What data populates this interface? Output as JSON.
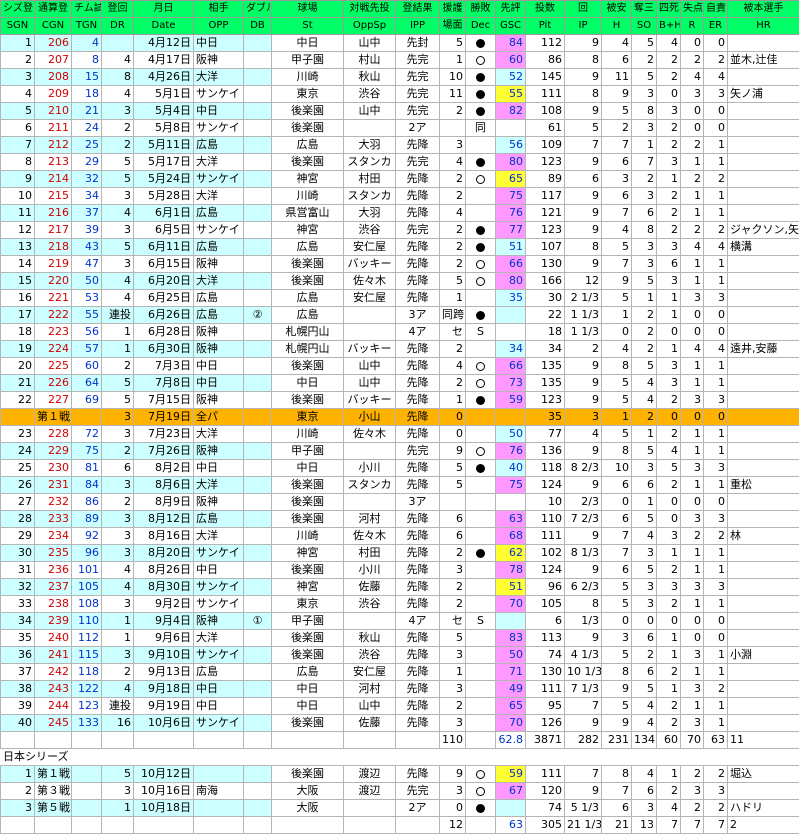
{
  "headers_jp": [
    "シズ登",
    "通算登",
    "チム試",
    "登回",
    "月日",
    "相手",
    "ダブル",
    "球場",
    "対戦先投",
    "登結果",
    "援護",
    "勝敗",
    "先評",
    "投数",
    "回",
    "被安",
    "奪三",
    "四死",
    "失点",
    "自責",
    "被本選手"
  ],
  "headers_en": [
    "SGN",
    "CGN",
    "TGN",
    "DR",
    "Date",
    "OPP",
    "DB",
    "St",
    "OppSp",
    "IPP",
    "場面",
    "Dec",
    "GSC",
    "Pit",
    "IP",
    "H",
    "SO",
    "B+H",
    "R",
    "ER",
    "HR"
  ],
  "rows": [
    {
      "sgn": "1",
      "cgn": "206",
      "tgn": "4",
      "dr": "",
      "date": "4月12日",
      "opp": "中日",
      "db": "",
      "st": "中日",
      "oppsp": "山中",
      "ipp": "先封",
      "sup": "5",
      "dec": "win",
      "gsc": "84",
      "gscColor": "pink",
      "pit": "112",
      "ip": "9",
      "h": "4",
      "so": "5",
      "bh": "4",
      "r": "0",
      "er": "0",
      "hr": ""
    },
    {
      "sgn": "2",
      "cgn": "207",
      "tgn": "8",
      "dr": "4",
      "date": "4月17日",
      "opp": "阪神",
      "db": "",
      "st": "甲子園",
      "oppsp": "村山",
      "ipp": "先完",
      "sup": "1",
      "dec": "loss",
      "gsc": "60",
      "gscColor": "pink",
      "pit": "86",
      "ip": "8",
      "h": "6",
      "so": "2",
      "bh": "2",
      "r": "2",
      "er": "2",
      "hr": "並木,辻佳"
    },
    {
      "sgn": "3",
      "cgn": "208",
      "tgn": "15",
      "dr": "8",
      "date": "4月26日",
      "opp": "大洋",
      "db": "",
      "st": "川崎",
      "oppsp": "秋山",
      "ipp": "先完",
      "sup": "10",
      "dec": "win",
      "gsc": "52",
      "gscColor": "cyan",
      "pit": "145",
      "ip": "9",
      "h": "11",
      "so": "5",
      "bh": "2",
      "r": "4",
      "er": "4",
      "hr": ""
    },
    {
      "sgn": "4",
      "cgn": "209",
      "tgn": "18",
      "dr": "4",
      "date": "5月1日",
      "opp": "サンケイ",
      "db": "",
      "st": "東京",
      "oppsp": "渋谷",
      "ipp": "先完",
      "sup": "11",
      "dec": "win",
      "gsc": "55",
      "gscColor": "yellow",
      "pit": "111",
      "ip": "8",
      "h": "9",
      "so": "3",
      "bh": "0",
      "r": "3",
      "er": "3",
      "hr": "矢ノ浦"
    },
    {
      "sgn": "5",
      "cgn": "210",
      "tgn": "21",
      "dr": "3",
      "date": "5月4日",
      "opp": "中日",
      "db": "",
      "st": "後楽園",
      "oppsp": "山中",
      "ipp": "先完",
      "sup": "2",
      "dec": "win",
      "gsc": "82",
      "gscColor": "pink",
      "pit": "108",
      "ip": "9",
      "h": "5",
      "so": "8",
      "bh": "3",
      "r": "0",
      "er": "0",
      "hr": ""
    },
    {
      "sgn": "6",
      "cgn": "211",
      "tgn": "24",
      "dr": "2",
      "date": "5月8日",
      "opp": "サンケイ",
      "db": "",
      "st": "後楽園",
      "oppsp": "",
      "ipp": "2ア",
      "sup": "",
      "dec": "同",
      "gsc": "",
      "gscColor": "",
      "pit": "61",
      "ip": "5",
      "h": "2",
      "so": "3",
      "bh": "2",
      "r": "0",
      "er": "0",
      "hr": ""
    },
    {
      "sgn": "7",
      "cgn": "212",
      "tgn": "25",
      "dr": "2",
      "date": "5月11日",
      "opp": "広島",
      "db": "",
      "st": "広島",
      "oppsp": "大羽",
      "ipp": "先降",
      "sup": "3",
      "dec": "",
      "gsc": "56",
      "gscColor": "cyan",
      "pit": "109",
      "ip": "7",
      "h": "7",
      "so": "1",
      "bh": "2",
      "r": "2",
      "er": "1",
      "hr": ""
    },
    {
      "sgn": "8",
      "cgn": "213",
      "tgn": "29",
      "dr": "5",
      "date": "5月17日",
      "opp": "大洋",
      "db": "",
      "st": "後楽園",
      "oppsp": "スタンカ",
      "ipp": "先完",
      "sup": "4",
      "dec": "win",
      "gsc": "80",
      "gscColor": "pink",
      "pit": "123",
      "ip": "9",
      "h": "6",
      "so": "7",
      "bh": "3",
      "r": "1",
      "er": "1",
      "hr": ""
    },
    {
      "sgn": "9",
      "cgn": "214",
      "tgn": "32",
      "dr": "5",
      "date": "5月24日",
      "opp": "サンケイ",
      "db": "",
      "st": "神宮",
      "oppsp": "村田",
      "ipp": "先降",
      "sup": "2",
      "dec": "loss",
      "gsc": "65",
      "gscColor": "yellow",
      "pit": "89",
      "ip": "6",
      "h": "3",
      "so": "2",
      "bh": "1",
      "r": "2",
      "er": "2",
      "hr": ""
    },
    {
      "sgn": "10",
      "cgn": "215",
      "tgn": "34",
      "dr": "3",
      "date": "5月28日",
      "opp": "大洋",
      "db": "",
      "st": "川崎",
      "oppsp": "スタンカ",
      "ipp": "先降",
      "sup": "2",
      "dec": "",
      "gsc": "75",
      "gscColor": "pink",
      "pit": "117",
      "ip": "9",
      "h": "6",
      "so": "3",
      "bh": "2",
      "r": "1",
      "er": "1",
      "hr": ""
    },
    {
      "sgn": "11",
      "cgn": "216",
      "tgn": "37",
      "dr": "4",
      "date": "6月1日",
      "opp": "広島",
      "db": "",
      "st": "県営富山",
      "oppsp": "大羽",
      "ipp": "先降",
      "sup": "4",
      "dec": "",
      "gsc": "76",
      "gscColor": "pink",
      "pit": "121",
      "ip": "9",
      "h": "7",
      "so": "6",
      "bh": "2",
      "r": "1",
      "er": "1",
      "hr": ""
    },
    {
      "sgn": "12",
      "cgn": "217",
      "tgn": "39",
      "dr": "3",
      "date": "6月5日",
      "opp": "サンケイ",
      "db": "",
      "st": "神宮",
      "oppsp": "渋谷",
      "ipp": "先完",
      "sup": "2",
      "dec": "win",
      "gsc": "77",
      "gscColor": "pink",
      "pit": "123",
      "ip": "9",
      "h": "4",
      "so": "8",
      "bh": "2",
      "r": "2",
      "er": "2",
      "hr": "ジャクソン,矢ノ浦"
    },
    {
      "sgn": "13",
      "cgn": "218",
      "tgn": "43",
      "dr": "5",
      "date": "6月11日",
      "opp": "広島",
      "db": "",
      "st": "広島",
      "oppsp": "安仁屋",
      "ipp": "先降",
      "sup": "2",
      "dec": "win",
      "gsc": "51",
      "gscColor": "cyan",
      "pit": "107",
      "ip": "8",
      "h": "5",
      "so": "3",
      "bh": "3",
      "r": "4",
      "er": "4",
      "hr": "横溝"
    },
    {
      "sgn": "14",
      "cgn": "219",
      "tgn": "47",
      "dr": "3",
      "date": "6月15日",
      "opp": "阪神",
      "db": "",
      "st": "後楽園",
      "oppsp": "バッキー",
      "ipp": "先降",
      "sup": "2",
      "dec": "loss",
      "gsc": "66",
      "gscColor": "pink",
      "pit": "130",
      "ip": "9",
      "h": "7",
      "so": "3",
      "bh": "6",
      "r": "1",
      "er": "1",
      "hr": ""
    },
    {
      "sgn": "15",
      "cgn": "220",
      "tgn": "50",
      "dr": "4",
      "date": "6月20日",
      "opp": "大洋",
      "db": "",
      "st": "後楽園",
      "oppsp": "佐々木",
      "ipp": "先降",
      "sup": "5",
      "dec": "loss",
      "gsc": "80",
      "gscColor": "pink",
      "pit": "166",
      "ip": "12",
      "h": "9",
      "so": "5",
      "bh": "3",
      "r": "1",
      "er": "1",
      "hr": ""
    },
    {
      "sgn": "16",
      "cgn": "221",
      "tgn": "53",
      "dr": "4",
      "date": "6月25日",
      "opp": "広島",
      "db": "",
      "st": "広島",
      "oppsp": "安仁屋",
      "ipp": "先降",
      "sup": "1",
      "dec": "",
      "gsc": "35",
      "gscColor": "cyan",
      "pit": "30",
      "ip": "2 1/3",
      "h": "5",
      "so": "1",
      "bh": "1",
      "r": "3",
      "er": "3",
      "hr": ""
    },
    {
      "sgn": "17",
      "cgn": "222",
      "tgn": "55",
      "dr": "連投",
      "date": "6月26日",
      "opp": "広島",
      "db": "②",
      "st": "広島",
      "oppsp": "",
      "ipp": "3ア",
      "sup": "同跨",
      "dec": "win",
      "gsc": "",
      "gscColor": "",
      "pit": "22",
      "ip": "1 1/3",
      "h": "1",
      "so": "2",
      "bh": "1",
      "r": "0",
      "er": "0",
      "hr": ""
    },
    {
      "sgn": "18",
      "cgn": "223",
      "tgn": "56",
      "dr": "1",
      "date": "6月28日",
      "opp": "阪神",
      "db": "",
      "st": "札幌円山",
      "oppsp": "",
      "ipp": "4ア",
      "sup": "セ",
      "dec": "S",
      "gsc": "",
      "gscColor": "",
      "pit": "18",
      "ip": "1 1/3",
      "h": "0",
      "so": "2",
      "bh": "0",
      "r": "0",
      "er": "0",
      "hr": ""
    },
    {
      "sgn": "19",
      "cgn": "224",
      "tgn": "57",
      "dr": "1",
      "date": "6月30日",
      "opp": "阪神",
      "db": "",
      "st": "札幌円山",
      "oppsp": "バッキー",
      "ipp": "先降",
      "sup": "2",
      "dec": "",
      "gsc": "34",
      "gscColor": "cyan",
      "pit": "34",
      "ip": "2",
      "h": "4",
      "so": "2",
      "bh": "1",
      "r": "4",
      "er": "4",
      "hr": "遠井,安藤"
    },
    {
      "sgn": "20",
      "cgn": "225",
      "tgn": "60",
      "dr": "2",
      "date": "7月3日",
      "opp": "中日",
      "db": "",
      "st": "後楽園",
      "oppsp": "山中",
      "ipp": "先降",
      "sup": "4",
      "dec": "loss",
      "gsc": "66",
      "gscColor": "pink",
      "pit": "135",
      "ip": "9",
      "h": "8",
      "so": "5",
      "bh": "3",
      "r": "1",
      "er": "1",
      "hr": ""
    },
    {
      "sgn": "21",
      "cgn": "226",
      "tgn": "64",
      "dr": "5",
      "date": "7月8日",
      "opp": "中日",
      "db": "",
      "st": "中日",
      "oppsp": "山中",
      "ipp": "先降",
      "sup": "2",
      "dec": "loss",
      "gsc": "73",
      "gscColor": "pink",
      "pit": "135",
      "ip": "9",
      "h": "5",
      "so": "4",
      "bh": "3",
      "r": "1",
      "er": "1",
      "hr": ""
    },
    {
      "sgn": "22",
      "cgn": "227",
      "tgn": "69",
      "dr": "5",
      "date": "7月15日",
      "opp": "阪神",
      "db": "",
      "st": "後楽園",
      "oppsp": "バッキー",
      "ipp": "先降",
      "sup": "1",
      "dec": "win",
      "gsc": "59",
      "gscColor": "pink",
      "pit": "123",
      "ip": "9",
      "h": "5",
      "so": "4",
      "bh": "2",
      "r": "3",
      "er": "3",
      "hr": ""
    },
    {
      "type": "allstar",
      "sgn": "",
      "cgn": "第１戦",
      "tgn": "",
      "dr": "3",
      "date": "7月19日",
      "opp": "全パ",
      "db": "",
      "st": "東京",
      "oppsp": "小山",
      "ipp": "先降",
      "sup": "0",
      "dec": "",
      "gsc": "",
      "gscColor": "",
      "pit": "35",
      "ip": "3",
      "h": "1",
      "so": "2",
      "bh": "0",
      "r": "0",
      "er": "0",
      "hr": ""
    },
    {
      "sgn": "23",
      "cgn": "228",
      "tgn": "72",
      "dr": "3",
      "date": "7月23日",
      "opp": "大洋",
      "db": "",
      "st": "川崎",
      "oppsp": "佐々木",
      "ipp": "先降",
      "sup": "0",
      "dec": "",
      "gsc": "50",
      "gscColor": "cyan",
      "pit": "77",
      "ip": "4",
      "h": "5",
      "so": "1",
      "bh": "2",
      "r": "1",
      "er": "1",
      "hr": ""
    },
    {
      "sgn": "24",
      "cgn": "229",
      "tgn": "75",
      "dr": "2",
      "date": "7月26日",
      "opp": "阪神",
      "db": "",
      "st": "甲子園",
      "oppsp": "",
      "ipp": "先完",
      "sup": "9",
      "dec": "loss",
      "gsc": "76",
      "gscColor": "pink",
      "pit": "136",
      "ip": "9",
      "h": "8",
      "so": "5",
      "bh": "4",
      "r": "1",
      "er": "1",
      "hr": ""
    },
    {
      "sgn": "25",
      "cgn": "230",
      "tgn": "81",
      "dr": "6",
      "date": "8月2日",
      "opp": "中日",
      "db": "",
      "st": "中日",
      "oppsp": "小川",
      "ipp": "先降",
      "sup": "5",
      "dec": "win",
      "gsc": "40",
      "gscColor": "cyan",
      "pit": "118",
      "ip": "8 2/3",
      "h": "10",
      "so": "3",
      "bh": "5",
      "r": "3",
      "er": "3",
      "hr": ""
    },
    {
      "sgn": "26",
      "cgn": "231",
      "tgn": "84",
      "dr": "3",
      "date": "8月6日",
      "opp": "大洋",
      "db": "",
      "st": "後楽園",
      "oppsp": "スタンカ",
      "ipp": "先降",
      "sup": "5",
      "dec": "",
      "gsc": "75",
      "gscColor": "pink",
      "pit": "124",
      "ip": "9",
      "h": "6",
      "so": "6",
      "bh": "2",
      "r": "1",
      "er": "1",
      "hr": "重松"
    },
    {
      "sgn": "27",
      "cgn": "232",
      "tgn": "86",
      "dr": "2",
      "date": "8月9日",
      "opp": "阪神",
      "db": "",
      "st": "後楽園",
      "oppsp": "",
      "ipp": "3ア",
      "sup": "",
      "dec": "",
      "gsc": "",
      "gscColor": "",
      "pit": "10",
      "ip": "2/3",
      "h": "0",
      "so": "1",
      "bh": "0",
      "r": "0",
      "er": "0",
      "hr": ""
    },
    {
      "sgn": "28",
      "cgn": "233",
      "tgn": "89",
      "dr": "3",
      "date": "8月12日",
      "opp": "広島",
      "db": "",
      "st": "後楽園",
      "oppsp": "河村",
      "ipp": "先降",
      "sup": "6",
      "dec": "",
      "gsc": "63",
      "gscColor": "pink",
      "pit": "110",
      "ip": "7 2/3",
      "h": "6",
      "so": "5",
      "bh": "0",
      "r": "3",
      "er": "3",
      "hr": ""
    },
    {
      "sgn": "29",
      "cgn": "234",
      "tgn": "92",
      "dr": "3",
      "date": "8月16日",
      "opp": "大洋",
      "db": "",
      "st": "川崎",
      "oppsp": "佐々木",
      "ipp": "先降",
      "sup": "6",
      "dec": "",
      "gsc": "68",
      "gscColor": "pink",
      "pit": "111",
      "ip": "9",
      "h": "7",
      "so": "4",
      "bh": "3",
      "r": "2",
      "er": "2",
      "hr": "林"
    },
    {
      "sgn": "30",
      "cgn": "235",
      "tgn": "96",
      "dr": "3",
      "date": "8月20日",
      "opp": "サンケイ",
      "db": "",
      "st": "神宮",
      "oppsp": "村田",
      "ipp": "先降",
      "sup": "2",
      "dec": "win",
      "gsc": "62",
      "gscColor": "yellow",
      "pit": "102",
      "ip": "8 1/3",
      "h": "7",
      "so": "3",
      "bh": "1",
      "r": "1",
      "er": "1",
      "hr": ""
    },
    {
      "sgn": "31",
      "cgn": "236",
      "tgn": "101",
      "dr": "4",
      "date": "8月26日",
      "opp": "中日",
      "db": "",
      "st": "後楽園",
      "oppsp": "小川",
      "ipp": "先降",
      "sup": "3",
      "dec": "",
      "gsc": "78",
      "gscColor": "pink",
      "pit": "124",
      "ip": "9",
      "h": "6",
      "so": "5",
      "bh": "2",
      "r": "1",
      "er": "1",
      "hr": ""
    },
    {
      "sgn": "32",
      "cgn": "237",
      "tgn": "105",
      "dr": "4",
      "date": "8月30日",
      "opp": "サンケイ",
      "db": "",
      "st": "神宮",
      "oppsp": "佐藤",
      "ipp": "先降",
      "sup": "2",
      "dec": "",
      "gsc": "51",
      "gscColor": "yellow",
      "pit": "96",
      "ip": "6 2/3",
      "h": "5",
      "so": "3",
      "bh": "3",
      "r": "3",
      "er": "3",
      "hr": ""
    },
    {
      "sgn": "33",
      "cgn": "238",
      "tgn": "108",
      "dr": "3",
      "date": "9月2日",
      "opp": "サンケイ",
      "db": "",
      "st": "東京",
      "oppsp": "渋谷",
      "ipp": "先降",
      "sup": "2",
      "dec": "",
      "gsc": "70",
      "gscColor": "pink",
      "pit": "105",
      "ip": "8",
      "h": "5",
      "so": "3",
      "bh": "2",
      "r": "1",
      "er": "1",
      "hr": ""
    },
    {
      "sgn": "34",
      "cgn": "239",
      "tgn": "110",
      "dr": "1",
      "date": "9月4日",
      "opp": "阪神",
      "db": "①",
      "st": "甲子園",
      "oppsp": "",
      "ipp": "4ア",
      "sup": "セ",
      "dec": "S",
      "gsc": "",
      "gscColor": "",
      "pit": "6",
      "ip": "1/3",
      "h": "0",
      "so": "0",
      "bh": "0",
      "r": "0",
      "er": "0",
      "hr": ""
    },
    {
      "sgn": "35",
      "cgn": "240",
      "tgn": "112",
      "dr": "1",
      "date": "9月6日",
      "opp": "大洋",
      "db": "",
      "st": "後楽園",
      "oppsp": "秋山",
      "ipp": "先降",
      "sup": "5",
      "dec": "",
      "gsc": "83",
      "gscColor": "pink",
      "pit": "113",
      "ip": "9",
      "h": "3",
      "so": "6",
      "bh": "1",
      "r": "0",
      "er": "0",
      "hr": ""
    },
    {
      "sgn": "36",
      "cgn": "241",
      "tgn": "115",
      "dr": "3",
      "date": "9月10日",
      "opp": "サンケイ",
      "db": "",
      "st": "後楽園",
      "oppsp": "渋谷",
      "ipp": "先降",
      "sup": "3",
      "dec": "",
      "gsc": "50",
      "gscColor": "pink",
      "pit": "74",
      "ip": "4 1/3",
      "h": "5",
      "so": "2",
      "bh": "1",
      "r": "3",
      "er": "1",
      "hr": "小淵"
    },
    {
      "sgn": "37",
      "cgn": "242",
      "tgn": "118",
      "dr": "2",
      "date": "9月13日",
      "opp": "広島",
      "db": "",
      "st": "広島",
      "oppsp": "安仁屋",
      "ipp": "先降",
      "sup": "1",
      "dec": "",
      "gsc": "71",
      "gscColor": "pink",
      "pit": "130",
      "ip": "10 1/3",
      "h": "8",
      "so": "6",
      "bh": "2",
      "r": "1",
      "er": "1",
      "hr": ""
    },
    {
      "sgn": "38",
      "cgn": "243",
      "tgn": "122",
      "dr": "4",
      "date": "9月18日",
      "opp": "中日",
      "db": "",
      "st": "中日",
      "oppsp": "河村",
      "ipp": "先降",
      "sup": "3",
      "dec": "",
      "gsc": "49",
      "gscColor": "pink",
      "pit": "111",
      "ip": "7 1/3",
      "h": "9",
      "so": "5",
      "bh": "1",
      "r": "3",
      "er": "2",
      "hr": ""
    },
    {
      "sgn": "39",
      "cgn": "244",
      "tgn": "123",
      "dr": "連投",
      "date": "9月19日",
      "opp": "中日",
      "db": "",
      "st": "中日",
      "oppsp": "山中",
      "ipp": "先降",
      "sup": "2",
      "dec": "",
      "gsc": "65",
      "gscColor": "pink",
      "pit": "95",
      "ip": "7",
      "h": "5",
      "so": "4",
      "bh": "2",
      "r": "1",
      "er": "1",
      "hr": ""
    },
    {
      "sgn": "40",
      "cgn": "245",
      "tgn": "133",
      "dr": "16",
      "date": "10月6日",
      "opp": "サンケイ",
      "db": "",
      "st": "後楽園",
      "oppsp": "佐藤",
      "ipp": "先降",
      "sup": "3",
      "dec": "",
      "gsc": "70",
      "gscColor": "pink",
      "pit": "126",
      "ip": "9",
      "h": "9",
      "so": "4",
      "bh": "2",
      "r": "3",
      "er": "1",
      "hr": ""
    }
  ],
  "season_total": {
    "sup": "110",
    "gsc": "62.8",
    "pit": "3871",
    "ip": "282",
    "h": "231",
    "so": "134",
    "bh": "60",
    "r": "70",
    "er": "63",
    "hr": "11"
  },
  "series_title": "日本シリーズ",
  "series_rows": [
    {
      "sgn": "1",
      "cgn": "第１戦",
      "tgn": "",
      "dr": "5",
      "date": "10月12日",
      "opp": "",
      "db": "",
      "st": "後楽園",
      "oppsp": "渡辺",
      "ipp": "先降",
      "sup": "9",
      "dec": "loss",
      "gsc": "59",
      "gscColor": "yellow",
      "pit": "111",
      "ip": "7",
      "h": "8",
      "so": "4",
      "bh": "1",
      "r": "2",
      "er": "2",
      "hr": "堀込"
    },
    {
      "sgn": "2",
      "cgn": "第３戦",
      "tgn": "",
      "dr": "3",
      "date": "10月16日",
      "opp": "南海",
      "db": "",
      "st": "大阪",
      "oppsp": "渡辺",
      "ipp": "先完",
      "sup": "3",
      "dec": "loss",
      "gsc": "67",
      "gscColor": "pink",
      "pit": "120",
      "ip": "9",
      "h": "7",
      "so": "6",
      "bh": "2",
      "r": "3",
      "er": "3",
      "hr": ""
    },
    {
      "sgn": "3",
      "cgn": "第５戦",
      "tgn": "",
      "dr": "1",
      "date": "10月18日",
      "opp": "",
      "db": "",
      "st": "大阪",
      "oppsp": "",
      "ipp": "2ア",
      "sup": "0",
      "dec": "win",
      "gsc": "",
      "gscColor": "",
      "pit": "74",
      "ip": "5 1/3",
      "h": "6",
      "so": "3",
      "bh": "4",
      "r": "2",
      "er": "2",
      "hr": "ハドリ"
    }
  ],
  "series_total": {
    "sup": "12",
    "gsc": "63",
    "pit": "305",
    "ip": "21 1/3",
    "h": "21",
    "so": "13",
    "bh": "7",
    "r": "7",
    "er": "7",
    "hr": "2"
  }
}
